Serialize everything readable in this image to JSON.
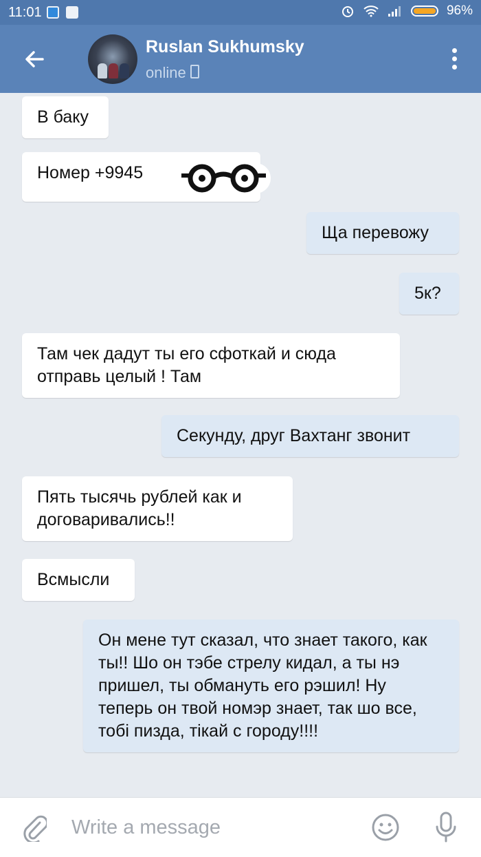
{
  "status_bar": {
    "time": "11:01",
    "battery": "96%"
  },
  "header": {
    "name": "Ruslan Sukhumsky",
    "status": "online"
  },
  "messages": [
    {
      "dir": "in",
      "text": "В баку"
    },
    {
      "dir": "in",
      "text": "Номер +9945"
    },
    {
      "dir": "out",
      "text": "Ща перевожу"
    },
    {
      "dir": "out",
      "text": "5к?"
    },
    {
      "dir": "in",
      "text": "Там чек дадут ты его сфоткай и сюда отправь целый ! Там"
    },
    {
      "dir": "out",
      "text": "Секунду, друг Вахтанг звонит"
    },
    {
      "dir": "in",
      "text": "Пять тысячь рублей как и договаривались!!"
    },
    {
      "dir": "in",
      "text": "Всмысли"
    },
    {
      "dir": "out",
      "text": "Он мене тут сказал, что знает такого, как ты!! Шо он тэбе стрелу кидал, а ты нэ пришел, ты обмануть его рэшил! Ну теперь он твой номэр знает, так шо все, тобі пизда, тікай с городу!!!!"
    }
  ],
  "composer": {
    "placeholder": "Write a message"
  },
  "icons": {
    "back": "back-arrow-icon",
    "menu": "more-vertical-icon",
    "attach": "paperclip-icon",
    "emoji": "smile-icon",
    "voice": "microphone-icon",
    "glasses": "glasses-sticker-icon"
  },
  "colors": {
    "header": "#5a83b8",
    "status_bar": "#4f78ad",
    "chat_bg": "#e7ebf0",
    "incoming": "#ffffff",
    "outgoing": "#dde8f4"
  }
}
